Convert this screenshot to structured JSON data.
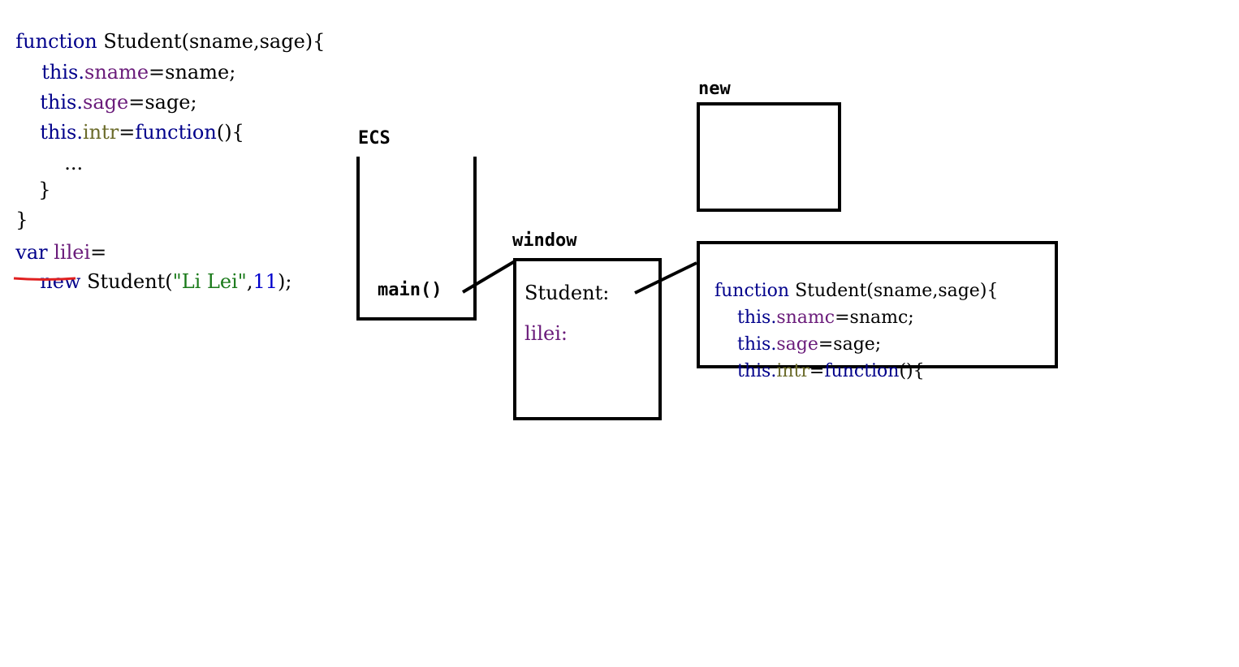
{
  "code": {
    "l1_kw": "function",
    "l1_rest": " Student(sname,sage){",
    "l2_this": "this.",
    "l2_prop": "sname",
    "l2_rest": "=sname;",
    "l3_this": "this.",
    "l3_prop": "sage",
    "l3_rest": "=sage;",
    "l4_this": "this.",
    "l4_prop": "intr",
    "l4_eq": "=",
    "l4_fn": "function",
    "l4_rest": "(){",
    "l5": "...",
    "l6": "}",
    "l7": "}",
    "l8_kw": "var",
    "l8_var": "lilei",
    "l8_rest": "=",
    "l9_new": "new",
    "l9_rest1": " Student(",
    "l9_str": "\"Li Lei\"",
    "l9_comma": ",",
    "l9_num": "11",
    "l9_end": ");"
  },
  "diagram": {
    "ecs_label": "ECS",
    "main_label": "main()",
    "window_label": "window",
    "window_student": "Student:",
    "window_lilei": "lilei:",
    "new_label": "new",
    "fn_box": {
      "l1_kw": "function",
      "l1_rest": " Student(sname,sage){",
      "l2_this": "this.",
      "l2_prop": "snamc",
      "l2_rest": "=snamc;",
      "l3_this": "this.",
      "l3_prop": "sage",
      "l3_rest": "=sage;",
      "l4_this": "this.",
      "l4_prop": "intr",
      "l4_eq": "=",
      "l4_fn": "function",
      "l4_rest": "(){"
    }
  },
  "colors": {
    "keyword": "#00008b",
    "property": "#6a1b7a",
    "string": "#1a7a1a",
    "number": "#0000cc",
    "underline": "#e02020"
  }
}
